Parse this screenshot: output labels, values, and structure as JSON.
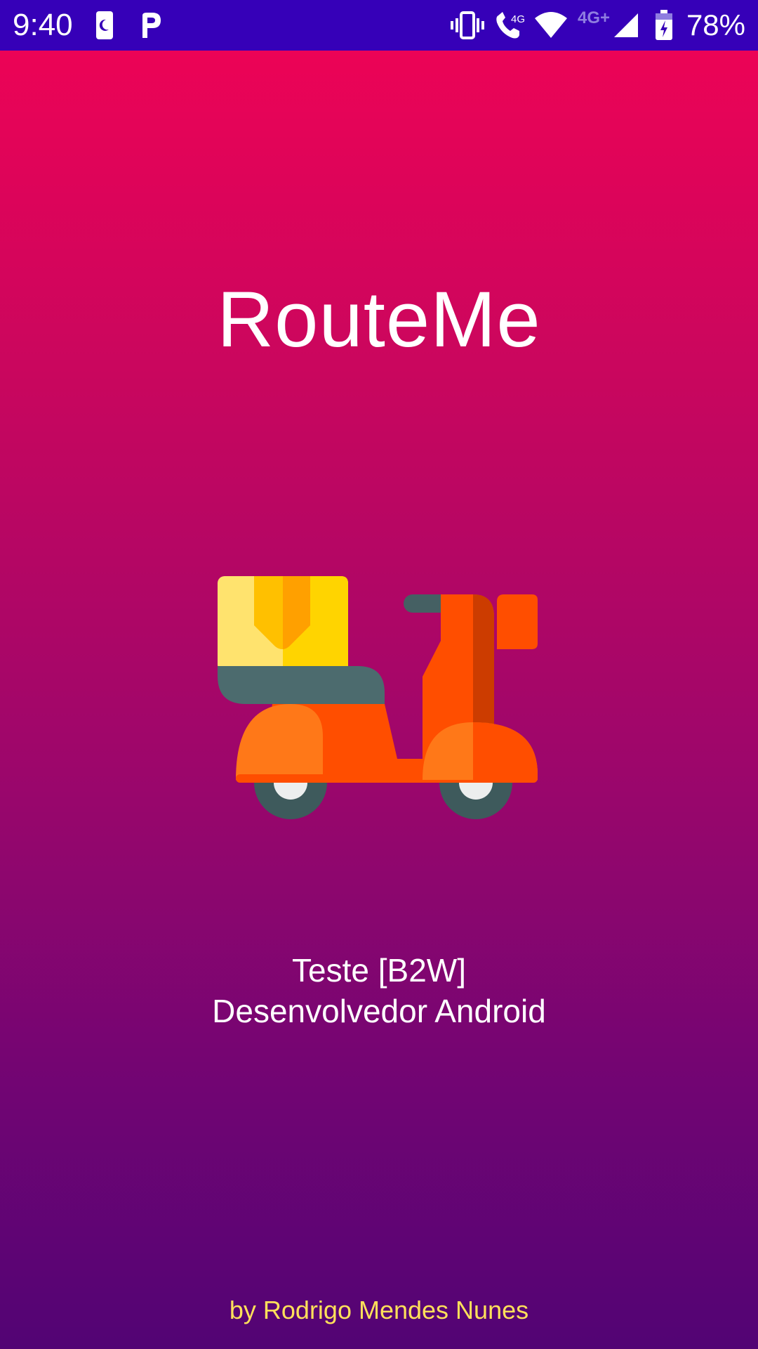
{
  "status_bar": {
    "time": "9:40",
    "battery_percent": "78%",
    "network_label": "4G",
    "network_label_secondary": "4G+",
    "icons": [
      "calendar-moon-icon",
      "parking-p-icon",
      "vibrate-icon",
      "wifi-calling-icon",
      "wifi-icon",
      "signal-icon",
      "battery-charging-icon"
    ],
    "color": "#3600b8"
  },
  "splash": {
    "title": "RouteMe",
    "subtitle_line1": "Teste [B2W]",
    "subtitle_line2": "Desenvolvedor Android",
    "author": "by Rodrigo Mendes Nunes",
    "illustration": "delivery-scooter-icon",
    "gradient_top": "#ec0356",
    "gradient_bottom": "#520474",
    "author_color": "#ffe05a"
  }
}
